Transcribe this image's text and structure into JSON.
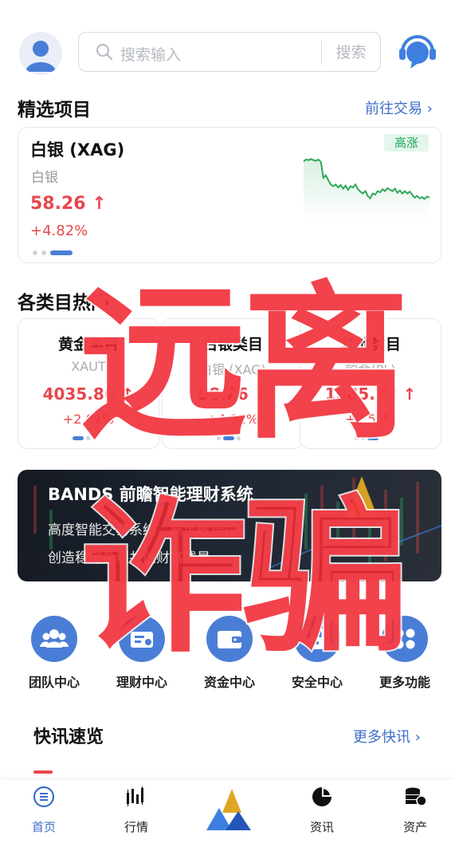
{
  "header": {
    "search_placeholder": "搜索输入",
    "search_button": "搜索"
  },
  "featured": {
    "title": "精选项目",
    "link": "前往交易 ›",
    "name": "白银 (XAG)",
    "subtitle": "白银",
    "price": "58.26 ↑",
    "change": "+4.82%",
    "badge": "高涨",
    "trend_values": [
      0.93,
      0.96,
      0.95,
      0.97,
      0.95,
      0.94,
      0.96,
      0.92,
      0.66,
      0.7,
      0.62,
      0.55,
      0.52,
      0.55,
      0.5,
      0.54,
      0.48,
      0.53,
      0.46,
      0.52,
      0.5,
      0.55,
      0.47,
      0.43,
      0.4,
      0.44,
      0.36,
      0.32,
      0.4,
      0.38,
      0.44,
      0.42,
      0.47,
      0.44,
      0.49,
      0.46,
      0.44,
      0.48,
      0.41,
      0.45,
      0.4,
      0.44,
      0.4,
      0.43,
      0.38,
      0.33,
      0.36,
      0.32,
      0.34,
      0.31,
      0.35,
      0.33
    ]
  },
  "categories": {
    "title": "各类目热门",
    "items": [
      {
        "name": "黄金类目",
        "symbol": "XAUT",
        "price": "4035.86 ↑",
        "change": "+2.07%"
      },
      {
        "name": "白银类目",
        "symbol": "白银 (XAG)",
        "price": "58.26 ↑",
        "change": "+4.82%"
      },
      {
        "name": "其他类目",
        "symbol": "铂金(PL)",
        "price": "1585.72 ↑",
        "change": "+2.59%"
      }
    ]
  },
  "banner": {
    "title": "BANDS 前瞻智能理财系统",
    "line1": "高度智能交易系统，高灵敏调控",
    "line2": "创造稳定盈利共创财富钱景"
  },
  "shortcuts": [
    {
      "label": "团队中心",
      "icon": "team-icon"
    },
    {
      "label": "理财中心",
      "icon": "finance-icon"
    },
    {
      "label": "资金中心",
      "icon": "wallet-icon"
    },
    {
      "label": "安全中心",
      "icon": "lock-icon"
    },
    {
      "label": "更多功能",
      "icon": "more-icon"
    }
  ],
  "news": {
    "title": "快讯速览",
    "more": "更多快讯 ›"
  },
  "nav": [
    {
      "label": "首页",
      "icon": "home-icon"
    },
    {
      "label": "行情",
      "icon": "candlestick-icon"
    },
    {
      "label": "",
      "icon": "brand-logo"
    },
    {
      "label": "资讯",
      "icon": "pie-chart-icon"
    },
    {
      "label": "资产",
      "icon": "coins-icon"
    }
  ],
  "watermark": {
    "line1": "远离",
    "line2": "诈骗"
  },
  "colors": {
    "up": "#e8474c",
    "accent": "#4a7ed6",
    "link": "#3d6ec9",
    "badge_bg": "#e4f6ec",
    "badge_text": "#1fa65b",
    "trend_line": "#2ea85c"
  }
}
